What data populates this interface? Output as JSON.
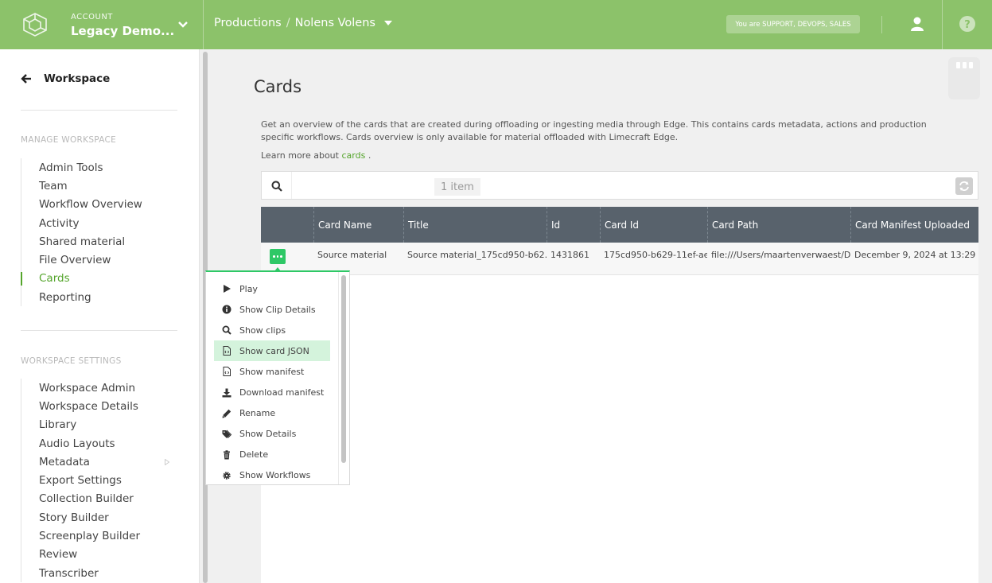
{
  "header": {
    "account_label": "ACCOUNT",
    "account_name": "Legacy Demo...",
    "breadcrumb": [
      "Productions",
      "Nolens Volens"
    ],
    "breadcrumb_sep": "/",
    "roles": "You are SUPPORT, DEVOPS, SALES"
  },
  "sidebar": {
    "back_label": "Workspace",
    "manage_title": "MANAGE WORKSPACE",
    "manage_items": [
      {
        "label": "Admin Tools"
      },
      {
        "label": "Team"
      },
      {
        "label": "Workflow Overview"
      },
      {
        "label": "Activity"
      },
      {
        "label": "Shared material"
      },
      {
        "label": "File Overview"
      },
      {
        "label": "Cards",
        "active": true
      },
      {
        "label": "Reporting"
      }
    ],
    "settings_title": "WORKSPACE SETTINGS",
    "settings_items": [
      {
        "label": "Workspace Admin"
      },
      {
        "label": "Workspace Details"
      },
      {
        "label": "Library"
      },
      {
        "label": "Audio Layouts"
      },
      {
        "label": "Metadata",
        "has_submenu": true
      },
      {
        "label": "Export Settings"
      },
      {
        "label": "Collection Builder"
      },
      {
        "label": "Story Builder"
      },
      {
        "label": "Screenplay Builder"
      },
      {
        "label": "Review"
      },
      {
        "label": "Transcriber"
      }
    ]
  },
  "main": {
    "title": "Cards",
    "description": "Get an overview of the cards that are created during offloading or ingesting media through Edge. This contains cards metadata, actions and production specific workflows. Cards overview is only available for material offloaded with Limecraft Edge.",
    "learn_prefix": "Learn more about",
    "learn_link": "cards",
    "learn_suffix": ".",
    "search_placeholder": "",
    "item_count": "1 item"
  },
  "table": {
    "columns": [
      "",
      "Card Name",
      "Title",
      "Id",
      "Card Id",
      "Card Path",
      "Card Manifest Uploaded"
    ],
    "rows": [
      {
        "card_name": "Source material",
        "title": "Source material_175cd950-b62...",
        "id": "1431861",
        "card_id": "175cd950-b629-11ef-ae...",
        "card_path": "file:///Users/maartenverwaest/De",
        "uploaded": "December 9, 2024 at 13:29"
      }
    ]
  },
  "menu": {
    "items": [
      {
        "label": "Play",
        "icon": "play-icon"
      },
      {
        "label": "Show Clip Details",
        "icon": "info-icon"
      },
      {
        "label": "Show clips",
        "icon": "search-icon"
      },
      {
        "label": "Show card JSON",
        "icon": "code-file-icon",
        "highlight": true
      },
      {
        "label": "Show manifest",
        "icon": "code-file-icon"
      },
      {
        "label": "Download manifest",
        "icon": "download-icon"
      },
      {
        "label": "Rename",
        "icon": "pencil-icon"
      },
      {
        "label": "Show Details",
        "icon": "tags-icon"
      },
      {
        "label": "Delete",
        "icon": "trash-icon"
      },
      {
        "label": "Show Workflows",
        "icon": "gear-icon"
      }
    ]
  },
  "colors": {
    "brand": "#8cc26a",
    "accent_green": "#2ec866",
    "active_link": "#55a52c",
    "table_header": "#58626c",
    "menu_highlight": "#d4f3dc"
  }
}
